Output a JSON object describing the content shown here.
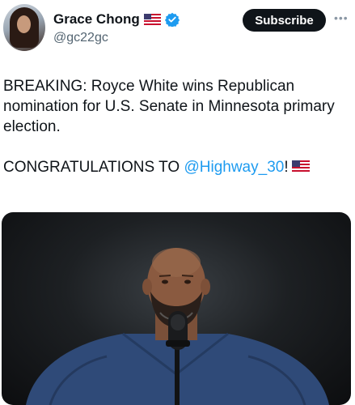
{
  "tweet": {
    "author": {
      "display_name": "Grace Chong",
      "handle": "@gc22gc",
      "name_emoji_icon": "us-flag-icon",
      "verified_icon": "verified-badge-icon"
    },
    "subscribe_label": "Subscribe",
    "more_icon": "ellipsis-icon",
    "text_line_1": "BREAKING: Royce White wins Republican nomination for U.S. Senate in Minnesota primary election.",
    "text_line_2_prefix": "CONGRATULATIONS TO ",
    "mention": "@Highway_30",
    "text_line_2_suffix": "!",
    "media": {
      "type": "image",
      "subject_icon": "man-at-microphone-photo"
    }
  },
  "colors": {
    "text": "#0f1419",
    "secondary_text": "#536471",
    "link": "#1d9bf0",
    "verified": "#1d9bf0",
    "subscribe_bg": "#0f1419"
  }
}
